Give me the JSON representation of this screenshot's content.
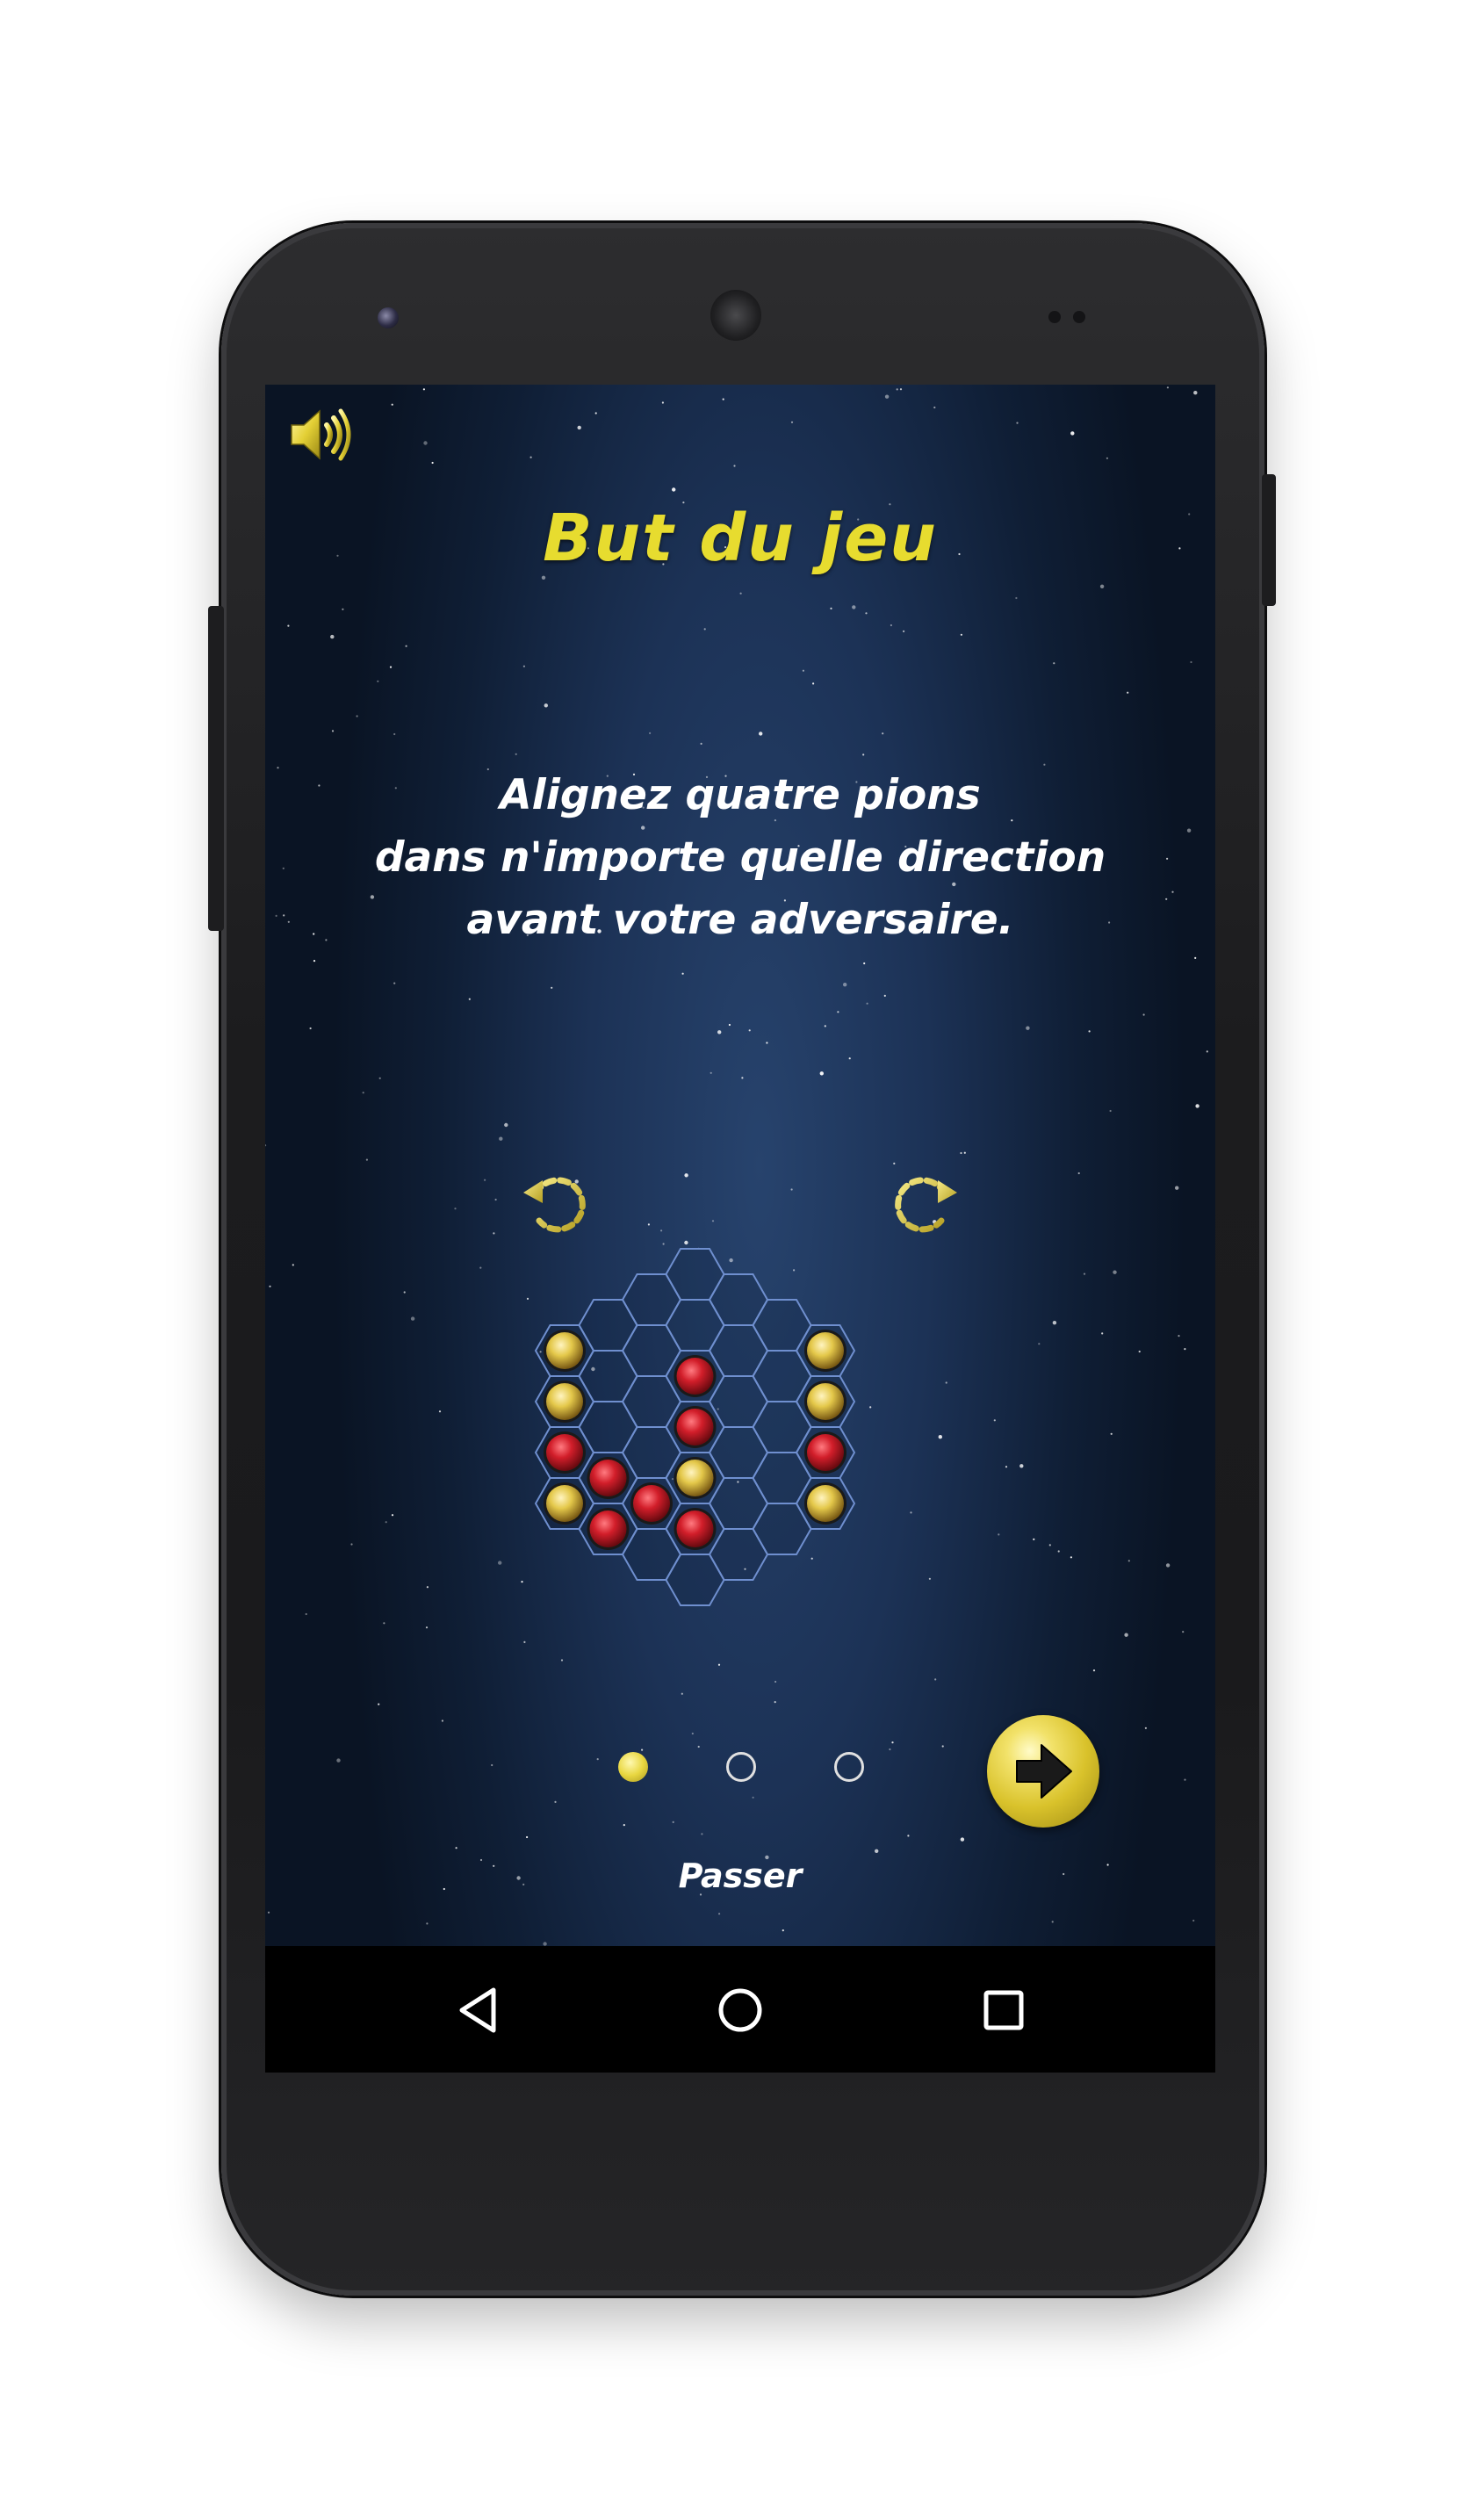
{
  "screen": {
    "title": "But du jeu",
    "description": [
      "Alignez quatre pions",
      "dans n'importe quelle direction",
      "avant votre adversaire."
    ],
    "skip_label": "Passer"
  },
  "icons": {
    "sound": "speaker-volume-icon",
    "rotate_left": "rotate-counterclockwise-icon",
    "rotate_right": "rotate-clockwise-icon",
    "next": "arrow-right-icon",
    "nav_back": "triangle-back-icon",
    "nav_home": "circle-home-icon",
    "nav_recents": "square-recents-icon"
  },
  "pagination": {
    "pages": 3,
    "current": 1
  },
  "colors": {
    "accent_yellow": "#e7dc2f",
    "hex_grid_line": "#6f8fcf",
    "red_piece": "#d21e2a",
    "yellow_piece": "#e4c84a"
  },
  "board": {
    "pieces": [
      {
        "col": 0,
        "row": 0,
        "color": "yellow"
      },
      {
        "col": 0,
        "row": 1,
        "color": "yellow"
      },
      {
        "col": 0,
        "row": 2,
        "color": "red"
      },
      {
        "col": 0,
        "row": 3,
        "color": "yellow"
      },
      {
        "col": 1,
        "row": 3,
        "color": "red"
      },
      {
        "col": 1,
        "row": 4,
        "color": "red"
      },
      {
        "col": 2,
        "row": 4,
        "color": "red"
      },
      {
        "col": 3,
        "row": 2,
        "color": "red"
      },
      {
        "col": 3,
        "row": 3,
        "color": "red"
      },
      {
        "col": 3,
        "row": 4,
        "color": "yellow"
      },
      {
        "col": 3,
        "row": 5,
        "color": "red"
      },
      {
        "col": 6,
        "row": 0,
        "color": "yellow"
      },
      {
        "col": 6,
        "row": 1,
        "color": "yellow"
      },
      {
        "col": 6,
        "row": 2,
        "color": "red"
      },
      {
        "col": 6,
        "row": 3,
        "color": "yellow"
      }
    ]
  }
}
